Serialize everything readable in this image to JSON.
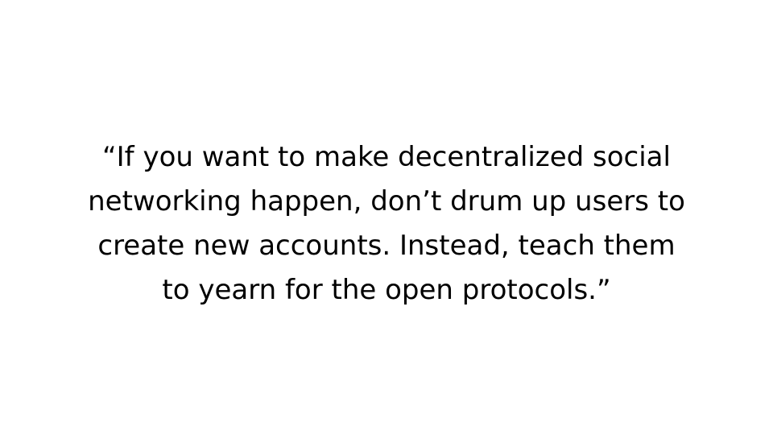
{
  "slide": {
    "quote_lines": [
      "“If you want to make decentralized social",
      "networking happen, don’t drum up users to",
      "create new accounts. Instead, teach them",
      "to yearn for the open protocols.”"
    ]
  },
  "colors": {
    "background": "#ffffff",
    "text": "#000000"
  }
}
